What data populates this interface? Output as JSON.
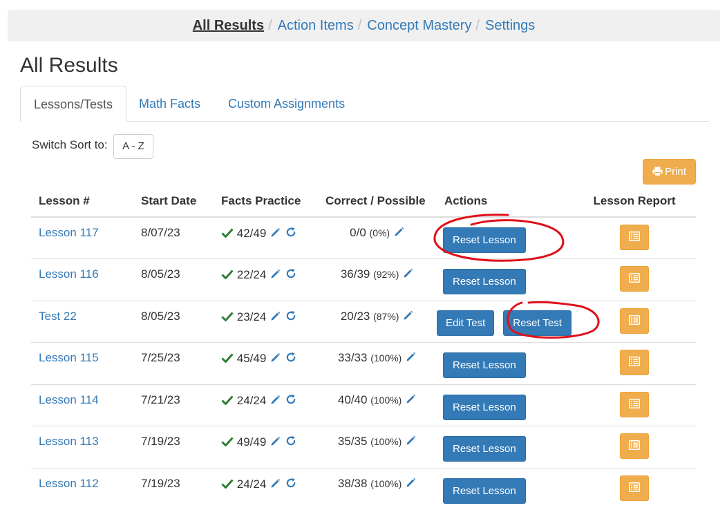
{
  "nav": {
    "items": [
      {
        "label": "All Results"
      },
      {
        "label": "Action Items"
      },
      {
        "label": "Concept Mastery"
      },
      {
        "label": "Settings"
      }
    ],
    "separator": "/"
  },
  "page_title": "All Results",
  "tabs": [
    {
      "label": "Lessons/Tests"
    },
    {
      "label": "Math Facts"
    },
    {
      "label": "Custom Assignments"
    }
  ],
  "sort": {
    "label": "Switch Sort to:",
    "button": "A - Z"
  },
  "print_label": "Print",
  "table": {
    "headers": [
      "Lesson #",
      "Start Date",
      "Facts Practice",
      "Correct / Possible",
      "Actions",
      "Lesson Report"
    ],
    "rows": [
      {
        "lesson": "Lesson 117",
        "date": "8/07/23",
        "facts": "42/49",
        "correct": "0/0",
        "pct": "(0%)",
        "actions": [
          "Reset Lesson"
        ]
      },
      {
        "lesson": "Lesson 116",
        "date": "8/05/23",
        "facts": "22/24",
        "correct": "36/39",
        "pct": "(92%)",
        "actions": [
          "Reset Lesson"
        ]
      },
      {
        "lesson": "Test 22",
        "date": "8/05/23",
        "facts": "23/24",
        "correct": "20/23",
        "pct": "(87%)",
        "actions": [
          "Edit Test",
          "Reset Test"
        ]
      },
      {
        "lesson": "Lesson 115",
        "date": "7/25/23",
        "facts": "45/49",
        "correct": "33/33",
        "pct": "(100%)",
        "actions": [
          "Reset Lesson"
        ]
      },
      {
        "lesson": "Lesson 114",
        "date": "7/21/23",
        "facts": "24/24",
        "correct": "40/40",
        "pct": "(100%)",
        "actions": [
          "Reset Lesson"
        ]
      },
      {
        "lesson": "Lesson 113",
        "date": "7/19/23",
        "facts": "49/49",
        "correct": "35/35",
        "pct": "(100%)",
        "actions": [
          "Reset Lesson"
        ]
      },
      {
        "lesson": "Lesson 112",
        "date": "7/19/23",
        "facts": "24/24",
        "correct": "38/38",
        "pct": "(100%)",
        "actions": [
          "Reset Lesson"
        ]
      }
    ]
  },
  "icons": {
    "check": "check-icon",
    "edit": "pencil-icon",
    "reset": "refresh-icon",
    "print": "printer-icon",
    "report": "list-alt-icon"
  },
  "colors": {
    "link": "#337ab7",
    "primary": "#337ab7",
    "warning": "#f0ad4e",
    "check": "#2e7d32",
    "annotation": "#e0101a"
  }
}
